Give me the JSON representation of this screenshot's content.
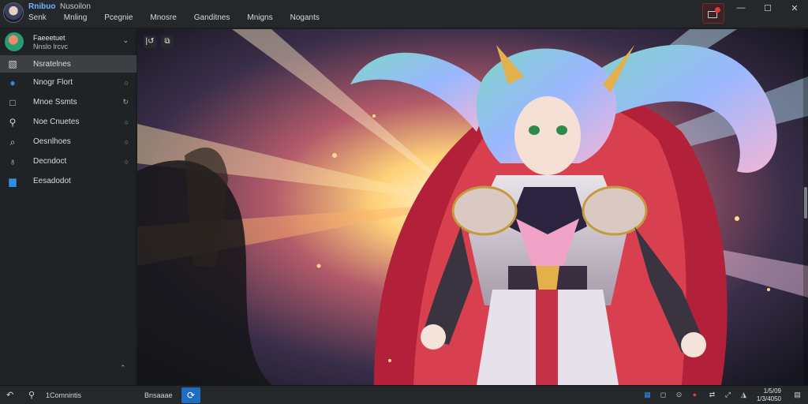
{
  "titlebar": {
    "app_title": "Rnibuo",
    "app_subtitle": "Nusoilon",
    "menu": [
      "Senk",
      "Mnling",
      "Pcegnie",
      "Mnosre",
      "Ganditnes",
      "Mnigns",
      "Nogants"
    ],
    "window_controls": [
      "—",
      "☐",
      "✕"
    ]
  },
  "sidebar": {
    "profile": {
      "name": "Faeeetuet",
      "status": "Nnslo lrcvc"
    },
    "items": [
      {
        "label": "Nsratelnes",
        "icon": "image-icon",
        "active": true,
        "mark": ""
      },
      {
        "label": "Nnogr Flort",
        "icon": "cloud-icon",
        "active": false,
        "mark": "○"
      },
      {
        "label": "Mnoe Ssmts",
        "icon": "square-icon",
        "active": false,
        "mark": "↻"
      },
      {
        "label": "Noe Cnuetes",
        "icon": "search-icon",
        "active": false,
        "mark": "○"
      },
      {
        "label": "Oesnlhoes",
        "icon": "tag-icon",
        "active": false,
        "mark": "○"
      },
      {
        "label": "Decndoct",
        "icon": "apple-icon",
        "active": false,
        "mark": "○"
      },
      {
        "label": "Eesadodot",
        "icon": "folder-icon",
        "active": false,
        "mark": ""
      }
    ]
  },
  "main": {
    "toolbar_icons": [
      "|↺",
      "⧉"
    ]
  },
  "statusbar": {
    "left_label": "1Comnintis",
    "center_label": "Bnsaaae",
    "clock_time": "1/5/09",
    "clock_date": "1/3/4050"
  },
  "colors": {
    "accent": "#1d6ec2",
    "title_accent": "#6fb4ff",
    "record": "#e53935"
  }
}
